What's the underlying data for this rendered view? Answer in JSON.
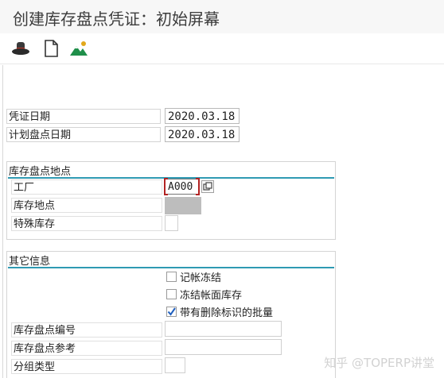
{
  "window": {
    "title": "创建库存盘点凭证：初始屏幕"
  },
  "toolbar": {
    "icons": [
      "hat-icon",
      "new-document-icon",
      "mountain-icon"
    ]
  },
  "header_fields": {
    "document_date": {
      "label": "凭证日期",
      "value": "2020.03.18"
    },
    "planned_count_date": {
      "label": "计划盘点日期",
      "value": "2020.03.18"
    }
  },
  "location_group": {
    "title": "库存盘点地点",
    "plant": {
      "label": "工厂",
      "value": "A000"
    },
    "storage_location": {
      "label": "库存地点",
      "value": ""
    },
    "special_stock": {
      "label": "特殊库存",
      "value": ""
    }
  },
  "other_group": {
    "title": "其它信息",
    "checkboxes": [
      {
        "label": "记帐冻结",
        "checked": false
      },
      {
        "label": "冻结帐面库存",
        "checked": false
      },
      {
        "label": "带有删除标识的批量",
        "checked": true
      }
    ],
    "count_doc_number": {
      "label": "库存盘点编号",
      "value": ""
    },
    "count_reference": {
      "label": "库存盘点参考",
      "value": ""
    },
    "grouping_type": {
      "label": "分组类型",
      "value": ""
    }
  },
  "watermark": "知乎 @TOPERP讲堂",
  "colors": {
    "accent": "#2f9ab3",
    "focus": "#b22222"
  }
}
